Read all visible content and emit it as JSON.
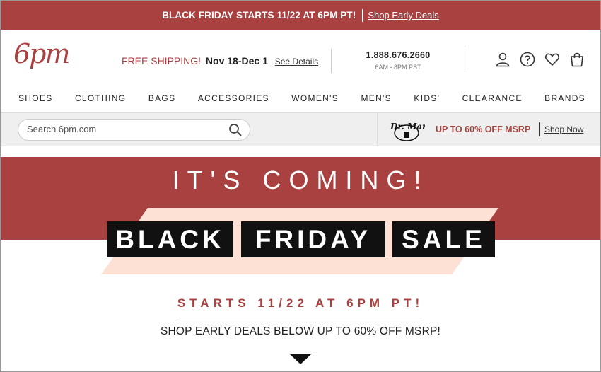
{
  "promo": {
    "headline": "BLACK FRIDAY STARTS 11/22 AT 6PM PT!",
    "link": "Shop Early Deals"
  },
  "header": {
    "logo": "6pm",
    "shipping": {
      "free": "FREE SHIPPING!",
      "dates": "Nov 18-Dec 1",
      "details": "See Details"
    },
    "phone": {
      "number": "1.888.676.2660",
      "hours": "6AM - 8PM PST"
    },
    "icons": [
      "account-icon",
      "help-icon",
      "favorites-heart-icon",
      "shopping-bag-icon"
    ]
  },
  "nav": [
    "SHOES",
    "CLOTHING",
    "BAGS",
    "ACCESSORIES",
    "WOMEN'S",
    "MEN'S",
    "KIDS'",
    "CLEARANCE",
    "BRANDS"
  ],
  "search": {
    "placeholder": "Search 6pm.com"
  },
  "brand_promo": {
    "logo_text": "Dr. Martens",
    "offer": "UP TO 60% OFF MSRP",
    "link": "Shop Now"
  },
  "hero": {
    "kicker": "IT'S COMING!",
    "words": [
      "BLACK",
      "FRIDAY",
      "SALE"
    ],
    "starts": "STARTS 11/22 AT 6PM PT!",
    "subline": "SHOP EARLY DEALS BELOW UP TO 60% OFF MSRP!"
  },
  "colors": {
    "brand_red": "#a94141",
    "peach": "#fde1d5",
    "black": "#111111"
  }
}
